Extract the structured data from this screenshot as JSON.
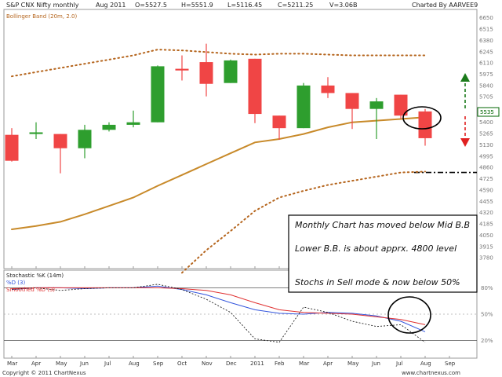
{
  "header": {
    "symbol": "S&P CNX Nifty monthly",
    "period": "Aug 2011",
    "open": "O=5527.5",
    "high": "H=5551.9",
    "low": "L=5116.45",
    "close": "C=5211.25",
    "volume": "V=3.06B",
    "charted_by": "Charted By AARVEE9"
  },
  "footer": {
    "copyright": "Copyright © 2011 ChartNexus",
    "url": "www.chartnexus.com"
  },
  "colors": {
    "up": "#2e9e2e",
    "down": "#f04545",
    "mid_band": "#c88a2a",
    "outer_band": "#b5651d",
    "stoch_k": "#3355dd",
    "stoch_d": "#e03030",
    "stoch_raw": "#222222"
  },
  "chart_data": [
    {
      "type": "candlestick",
      "title": "S&P CNX Nifty monthly",
      "indicator_label": "Bollinger Band (20m, 2.0)",
      "current_price_label": "5535",
      "categories": [
        "Mar",
        "Apr",
        "May",
        "Jun",
        "Jul",
        "Aug",
        "Sep",
        "Oct",
        "Nov",
        "Dec",
        "2011",
        "Feb",
        "Mar",
        "Apr",
        "May",
        "Jun",
        "Jul",
        "Aug",
        "Sep"
      ],
      "ohlc": [
        {
          "x": "Mar",
          "open": 5250,
          "high": 5330,
          "low": 4930,
          "close": 4940
        },
        {
          "x": "Apr",
          "open": 5260,
          "high": 5400,
          "low": 5200,
          "close": 5280
        },
        {
          "x": "May",
          "open": 5260,
          "high": 5260,
          "low": 4790,
          "close": 5090
        },
        {
          "x": "Jun",
          "open": 5090,
          "high": 5370,
          "low": 4970,
          "close": 5310
        },
        {
          "x": "Jul",
          "open": 5310,
          "high": 5400,
          "low": 5290,
          "close": 5370
        },
        {
          "x": "Aug",
          "open": 5370,
          "high": 5540,
          "low": 5340,
          "close": 5400
        },
        {
          "x": "Sep",
          "open": 5400,
          "high": 6080,
          "low": 5400,
          "close": 6070
        },
        {
          "x": "Oct",
          "open": 6040,
          "high": 6200,
          "low": 5900,
          "close": 6020
        },
        {
          "x": "Nov",
          "open": 6120,
          "high": 6340,
          "low": 5710,
          "close": 5860
        },
        {
          "x": "Dec",
          "open": 5870,
          "high": 6150,
          "low": 5870,
          "close": 6140
        },
        {
          "x": "2011",
          "open": 6160,
          "high": 6160,
          "low": 5390,
          "close": 5500
        },
        {
          "x": "Feb",
          "open": 5480,
          "high": 5480,
          "low": 5190,
          "close": 5330
        },
        {
          "x": "Mar",
          "open": 5330,
          "high": 5870,
          "low": 5330,
          "close": 5840
        },
        {
          "x": "Apr",
          "open": 5840,
          "high": 5940,
          "low": 5690,
          "close": 5750
        },
        {
          "x": "May",
          "open": 5750,
          "high": 5750,
          "low": 5320,
          "close": 5560
        },
        {
          "x": "Jun",
          "open": 5560,
          "high": 5690,
          "low": 5200,
          "close": 5650
        },
        {
          "x": "Jul",
          "open": 5730,
          "high": 5730,
          "low": 5440,
          "close": 5480
        },
        {
          "x": "Aug",
          "open": 5530,
          "high": 5560,
          "low": 5120,
          "close": 5210
        }
      ],
      "series": [
        {
          "role": "upper_band",
          "values": [
            5950,
            6000,
            6050,
            6100,
            6150,
            6200,
            6270,
            6260,
            6240,
            6220,
            6210,
            6220,
            6220,
            6210,
            6200,
            6200,
            6200,
            6200
          ]
        },
        {
          "role": "middle_band",
          "values": [
            4120,
            4160,
            4210,
            4300,
            4400,
            4500,
            4640,
            4770,
            4900,
            5030,
            5160,
            5200,
            5260,
            5340,
            5400,
            5420,
            5440,
            5460
          ]
        },
        {
          "role": "lower_band",
          "values": [
            null,
            null,
            null,
            null,
            null,
            null,
            null,
            3600,
            3870,
            4100,
            4340,
            4500,
            4580,
            4650,
            4700,
            4750,
            4800,
            4810
          ]
        }
      ],
      "yticks": [
        6650,
        6515,
        6380,
        6245,
        6110,
        5975,
        5840,
        5705,
        5535,
        5400,
        5265,
        5130,
        4995,
        4860,
        4725,
        4590,
        4455,
        4320,
        4185,
        4050,
        3915,
        3780
      ],
      "ylim": [
        3650,
        6750
      ],
      "reference_line": 4800,
      "annotations": [
        "Monthly Chart has moved below Mid B.B",
        "Lower B.B. is about apprx. 4800 level",
        "Stochs in Sell mode & now below 50%"
      ]
    },
    {
      "type": "line",
      "title": "Stochastic %K (14m)",
      "categories": [
        "Mar",
        "Apr",
        "May",
        "Jun",
        "Jul",
        "Aug",
        "Sep",
        "Oct",
        "Nov",
        "Dec",
        "2011",
        "Feb",
        "Mar",
        "Apr",
        "May",
        "Jun",
        "Jul",
        "Aug",
        "Sep"
      ],
      "series": [
        {
          "name": "%D (3)",
          "values": [
            78,
            80,
            80,
            79,
            80,
            80,
            82,
            78,
            72,
            63,
            55,
            51,
            50,
            52,
            51,
            48,
            42,
            30
          ]
        },
        {
          "name": "Smoothed %D (3)",
          "values": [
            79,
            80,
            80,
            80,
            80,
            80,
            80,
            79,
            77,
            72,
            63,
            55,
            52,
            51,
            50,
            47,
            44,
            38
          ]
        },
        {
          "name": "Stochastic %K (14m)",
          "values": [
            78,
            80,
            77,
            79,
            80,
            80,
            84,
            78,
            67,
            52,
            22,
            18,
            58,
            52,
            42,
            36,
            38,
            18
          ]
        }
      ],
      "yticks": [
        "80%",
        "50%",
        "20%"
      ],
      "ylim": [
        0,
        100
      ]
    }
  ]
}
